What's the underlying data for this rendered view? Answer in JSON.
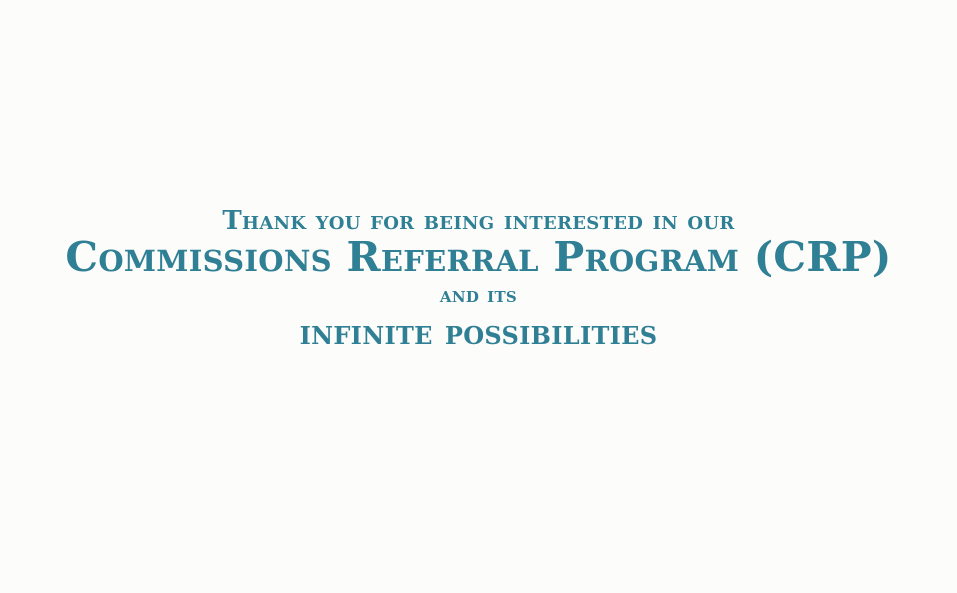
{
  "hero": {
    "line1": "Thank you for being interested in our",
    "line2": "Commissions Referral Program (CRP)",
    "line3": "and its",
    "line4": "infinite possibilities"
  },
  "colors": {
    "background": "#fcfcfa",
    "text": "#2f7f95"
  }
}
